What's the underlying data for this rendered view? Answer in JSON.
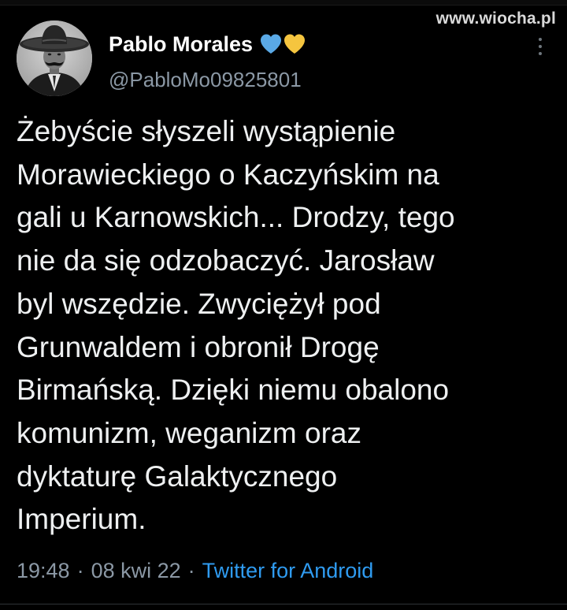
{
  "watermark": "www.wiocha.pl",
  "author": {
    "display_name": "Pablo Morales",
    "handle": "@PabloMo09825801",
    "badges": [
      "blue-heart-icon",
      "yellow-heart-icon"
    ]
  },
  "tweet": {
    "text": "Żebyście słyszeli wystąpienie\nMorawieckiego o Kaczyńskim na\ngali u Karnowskich... Drodzy, tego\nnie da się odzobaczyć. Jarosław\nbyl wszędzie. Zwyciężył pod\nGrunwaldem i obronił Drogę\nBirmańską. Dzięki niemu obalono\nkomunizm, weganizm oraz\ndyktaturę Galaktycznego\nImperium.",
    "time": "19:48",
    "date": "08 kwi 22",
    "source": "Twitter for Android",
    "separator": "·"
  },
  "colors": {
    "background": "#000000",
    "text": "#e7e9ea",
    "secondary": "#8b98a5",
    "link": "#2f9bf0",
    "heart_blue": "#5aa9e6",
    "heart_yellow": "#f5c53f"
  },
  "icons": {
    "more": "more-options-icon"
  }
}
